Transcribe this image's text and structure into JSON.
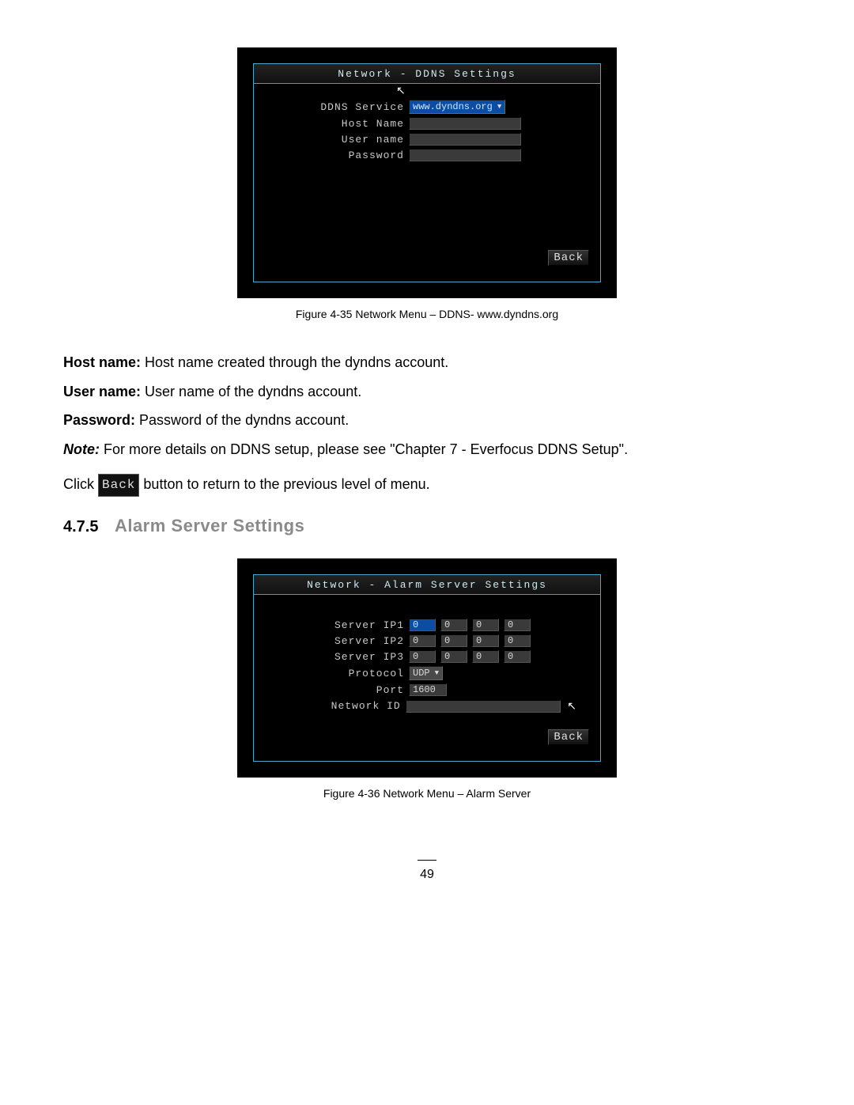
{
  "figure1": {
    "osd_title": "Network - DDNS Settings",
    "rows": {
      "ddns_service_label": "DDNS Service",
      "ddns_service_value": "www.dyndns.org",
      "host_name_label": "Host Name",
      "user_name_label": "User name",
      "password_label": "Password"
    },
    "back_label": "Back",
    "caption": "Figure 4-35 Network Menu –  DDNS- www.dyndns.org"
  },
  "body_text": {
    "host_name_bold": "Host name:",
    "host_name_text": " Host name created through the dyndns account.",
    "user_name_bold": "User name:",
    "user_name_text": " User name of the dyndns account.",
    "password_bold": "Password:",
    "password_text": " Password of the dyndns account.",
    "note_bold": "Note:",
    "note_text": " For more details on DDNS setup, please see \"Chapter 7 - Everfocus DDNS Setup\".",
    "click_pre": "Click ",
    "inline_back": "Back",
    "click_post": " button to return to the previous level of menu."
  },
  "section": {
    "number": "4.7.5",
    "title": "Alarm Server Settings"
  },
  "figure2": {
    "osd_title": "Network - Alarm Server Settings",
    "labels": {
      "server_ip1": "Server IP1",
      "server_ip2": "Server IP2",
      "server_ip3": "Server IP3",
      "protocol": "Protocol",
      "port": "Port",
      "network_id": "Network ID"
    },
    "values": {
      "ip1": [
        "0",
        "0",
        "0",
        "0"
      ],
      "ip2": [
        "0",
        "0",
        "0",
        "0"
      ],
      "ip3": [
        "0",
        "0",
        "0",
        "0"
      ],
      "protocol": "UDP",
      "port": "1600"
    },
    "back_label": "Back",
    "caption": "Figure 4-36  Network Menu – Alarm Server"
  },
  "page_number": "49"
}
